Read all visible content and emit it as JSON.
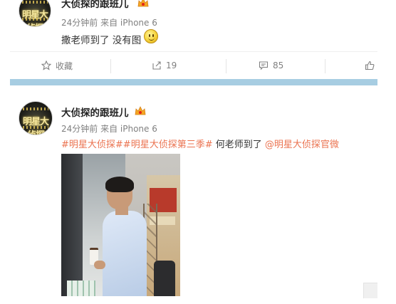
{
  "post_top": {
    "username": "大侦探的跟班儿",
    "meta": "24分钟前 来自 iPhone 6",
    "text": "撒老师到了 没有图",
    "emoji": "smiley-face-emoji"
  },
  "actions": {
    "favorite_label": "收藏",
    "forward_count": "19",
    "comment_count": "85",
    "icons": {
      "favorite": "star-icon",
      "forward": "share-arrow-icon",
      "comment": "comment-bubble-icon",
      "like": "thumbs-up-icon"
    }
  },
  "post": {
    "username": "大侦探的跟班儿",
    "meta": "24分钟前 来自 iPhone 6",
    "topic1": "#明星大侦探#",
    "topic2": "#明星大侦探第三季#",
    "body": " 何老师到了 ",
    "mention": "@明星大侦探官微",
    "avatar_text": "明星大侦探"
  },
  "colors": {
    "link": "#eb7350",
    "divider": "#a7cde2",
    "meta": "#808080",
    "text": "#333333"
  }
}
